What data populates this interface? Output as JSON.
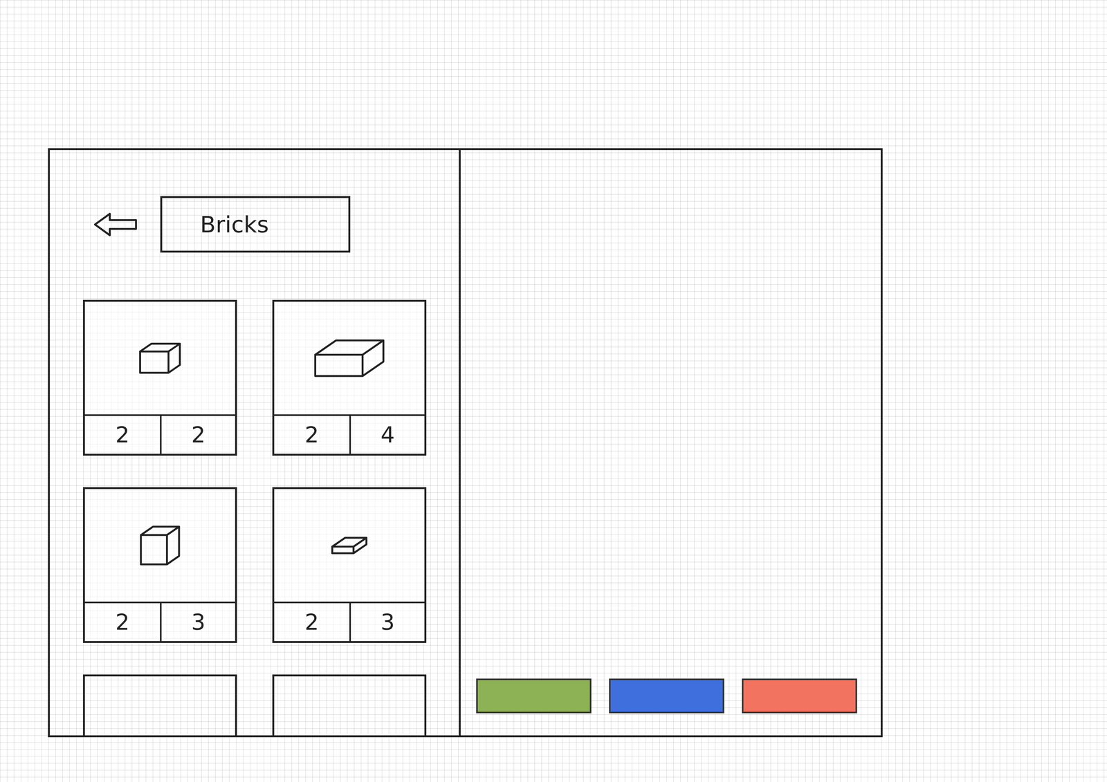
{
  "header": {
    "title": "Bricks"
  },
  "bricks": [
    {
      "kind": "cube",
      "numbers": [
        "2",
        "2"
      ]
    },
    {
      "kind": "long",
      "numbers": [
        "2",
        "4"
      ]
    },
    {
      "kind": "tall",
      "numbers": [
        "2",
        "3"
      ]
    },
    {
      "kind": "plate",
      "numbers": [
        "2",
        "3"
      ]
    }
  ],
  "color_buttons": [
    {
      "color": "#8db255"
    },
    {
      "color": "#3f6fdc"
    },
    {
      "color": "#f2735f"
    }
  ]
}
